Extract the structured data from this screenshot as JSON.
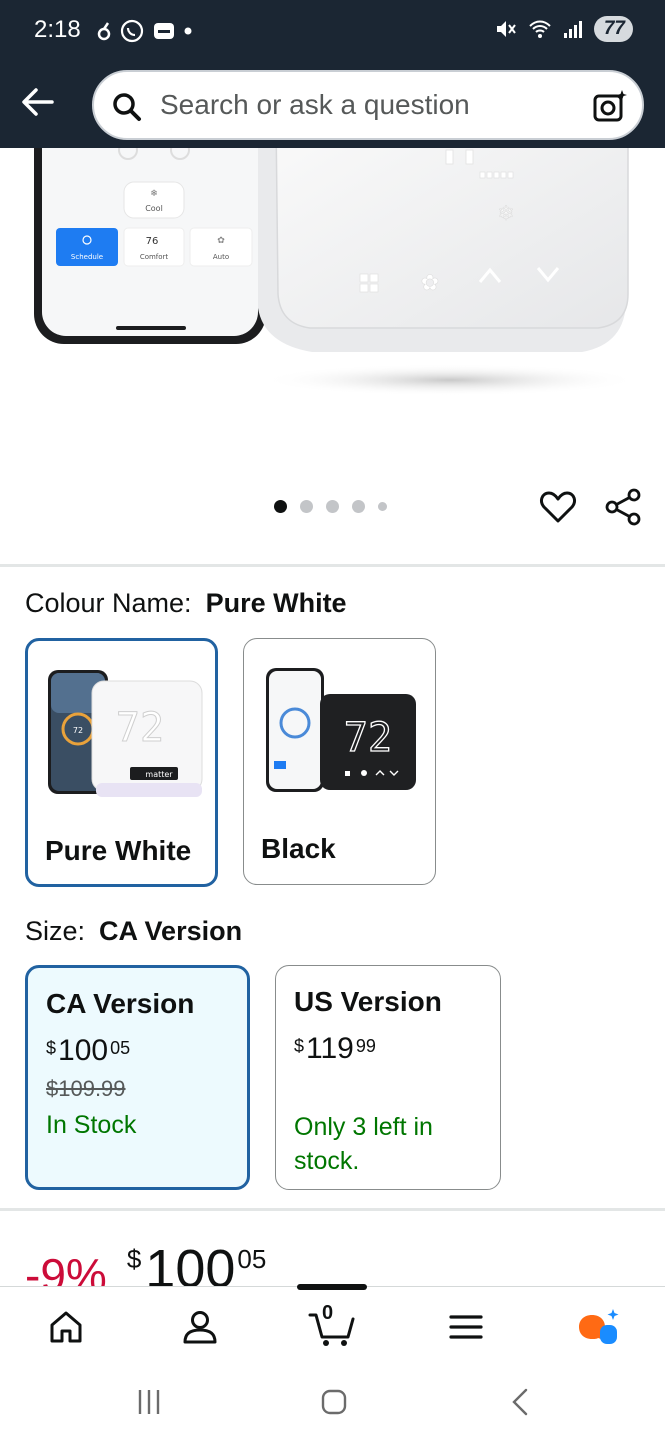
{
  "status_bar": {
    "time": "2:18",
    "battery": "77"
  },
  "search": {
    "placeholder": "Search or ask a question"
  },
  "carousel": {
    "total_dots": 5,
    "active_index": 0
  },
  "colour": {
    "label": "Colour Name:",
    "selected": "Pure White",
    "options": [
      {
        "label": "Pure White",
        "selected": true
      },
      {
        "label": "Black",
        "selected": false
      }
    ]
  },
  "product_screen": {
    "temp_reading": "72",
    "phone_temp": "72"
  },
  "phone_app": {
    "cool_label": "Cool",
    "schedule_label": "Schedule",
    "comfort_temp": "76",
    "comfort_label": "Comfort",
    "auto_label": "Auto"
  },
  "swatch_badge": {
    "matter": "matter"
  },
  "size": {
    "label": "Size:",
    "selected": "CA Version",
    "options": [
      {
        "title": "CA Version",
        "price_whole": "100",
        "price_fraction": "05",
        "currency": "$",
        "list_price": "$109.99",
        "stock": "In Stock",
        "selected": true
      },
      {
        "title": "US Version",
        "price_whole": "119",
        "price_fraction": "99",
        "currency": "$",
        "stock": "Only 3 left in stock.",
        "selected": false
      }
    ]
  },
  "price_summary": {
    "discount": "-9%",
    "currency": "$",
    "whole": "100",
    "fraction": "05"
  },
  "bottom_nav": {
    "cart_count": "0"
  },
  "colors": {
    "header_bg": "#1b2633",
    "selected_border": "#2162a1",
    "in_stock": "#007600",
    "discount": "#cc0c39",
    "rufus_orange": "#ff6a14",
    "rufus_blue": "#1a8cff"
  }
}
